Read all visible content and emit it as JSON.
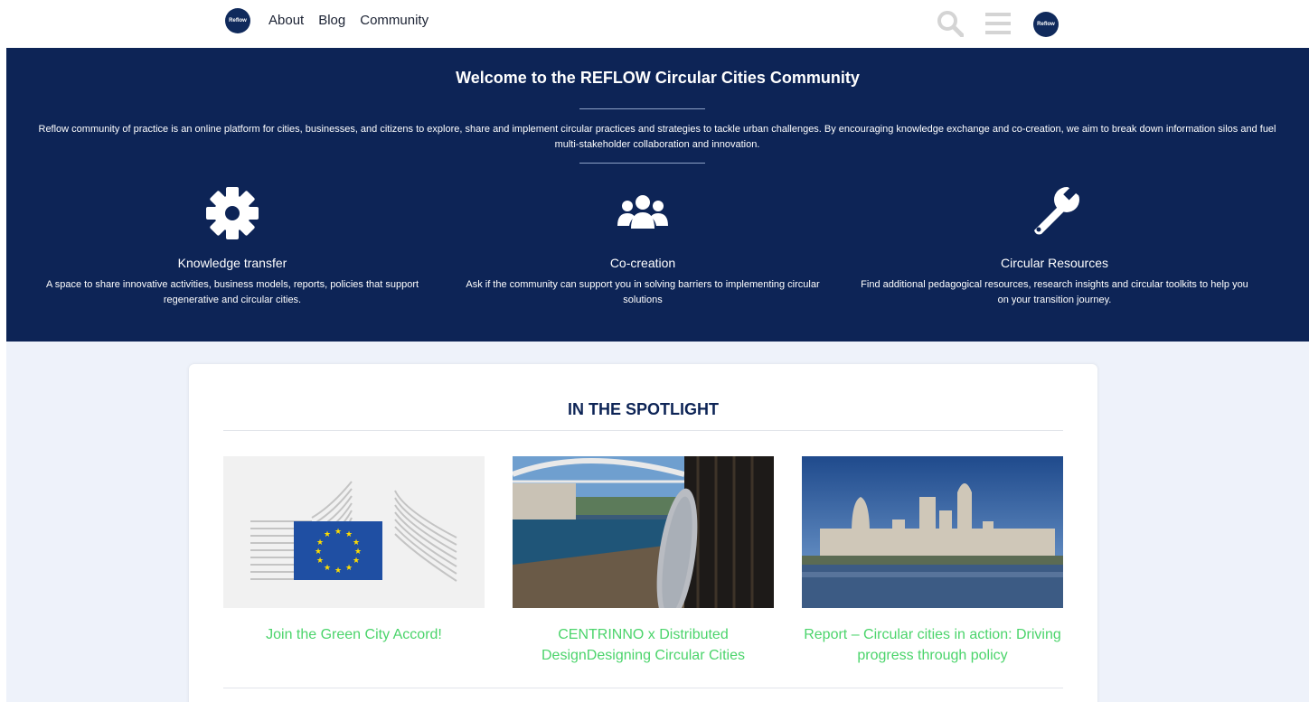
{
  "nav": {
    "logo_text": "Reflow",
    "links": [
      {
        "label": "About"
      },
      {
        "label": "Blog"
      },
      {
        "label": "Community"
      }
    ],
    "icons": [
      "search-icon",
      "menu-icon",
      "profile-logo"
    ]
  },
  "hero": {
    "title": "Welcome to the REFLOW Circular Cities Community",
    "description": "Reflow community of practice is an online platform for cities, businesses, and citizens to explore, share and implement circular practices and strategies to tackle urban challenges. By encouraging knowledge exchange and co-creation, we aim to break down information silos and fuel multi-stakeholder collaboration and innovation.",
    "features": [
      {
        "icon": "gear-icon",
        "title": "Knowledge transfer",
        "description": "A space to share innovative activities, business models, reports, policies that support regenerative and circular cities."
      },
      {
        "icon": "users-icon",
        "title": "Co-creation",
        "description": "Ask if the community can support you in solving barriers to implementing circular solutions"
      },
      {
        "icon": "wrench-icon",
        "title": "Circular Resources",
        "description": "Find additional pedagogical resources, research insights and circular toolkits to help you on your transition journey."
      }
    ]
  },
  "spotlight": {
    "title": "IN THE SPOTLIGHT",
    "items": [
      {
        "image": "eu-commission-flag-image",
        "title": "Join the Green City Accord!"
      },
      {
        "image": "porto-river-bridge-image",
        "title": "CENTRINNO x Distributed DesignDesigning Circular Cities"
      },
      {
        "image": "london-skyline-image",
        "title": "Report – Circular cities in action: Driving progress through policy"
      }
    ]
  },
  "colors": {
    "hero_bg": "#0d2456",
    "accent_green": "#4bd46b",
    "page_bg": "#eef2fa"
  }
}
